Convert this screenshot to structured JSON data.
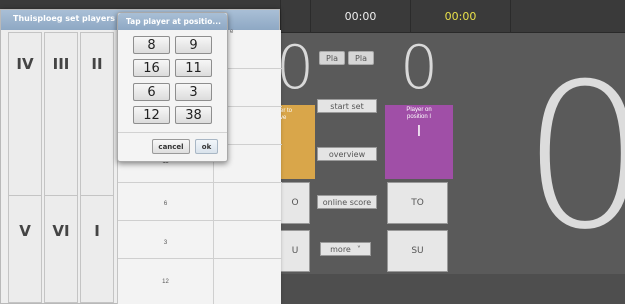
{
  "topbar": {
    "time_1": "00:00",
    "time_2": "00:00",
    "time_2_color": "#e8e04a"
  },
  "scoreboard": {
    "left_digit": "0",
    "middle_digit": "0",
    "right_digit": "0",
    "pla_button_1": "Pla",
    "pla_button_2": "Pla",
    "start_set": "start  set",
    "overview": "overview",
    "online_score": "online score",
    "more": "more",
    "more_arrow": "˅",
    "left_panel_text": "er to\nve",
    "left_to": "O",
    "left_su": "U",
    "player_label": "Player on\nposition I",
    "player_position": "I",
    "right_to": "TO",
    "right_su": "SU",
    "colors": {
      "orange": "#d9a64a",
      "purple": "#a04fa7"
    }
  },
  "players_dialog": {
    "title": "Thuisploeg set players",
    "positions_top": [
      "IV",
      "III",
      "II"
    ],
    "positions_bottom": [
      "V",
      "VI",
      "I"
    ],
    "numbers": [
      "11",
      "6",
      "3",
      "12"
    ],
    "header_fragment": "e"
  },
  "tap_popup": {
    "title": "Tap player at positio...",
    "numbers": [
      "8",
      "9",
      "16",
      "11",
      "6",
      "3",
      "12",
      "38"
    ],
    "cancel": "cancel",
    "ok": "ok"
  }
}
